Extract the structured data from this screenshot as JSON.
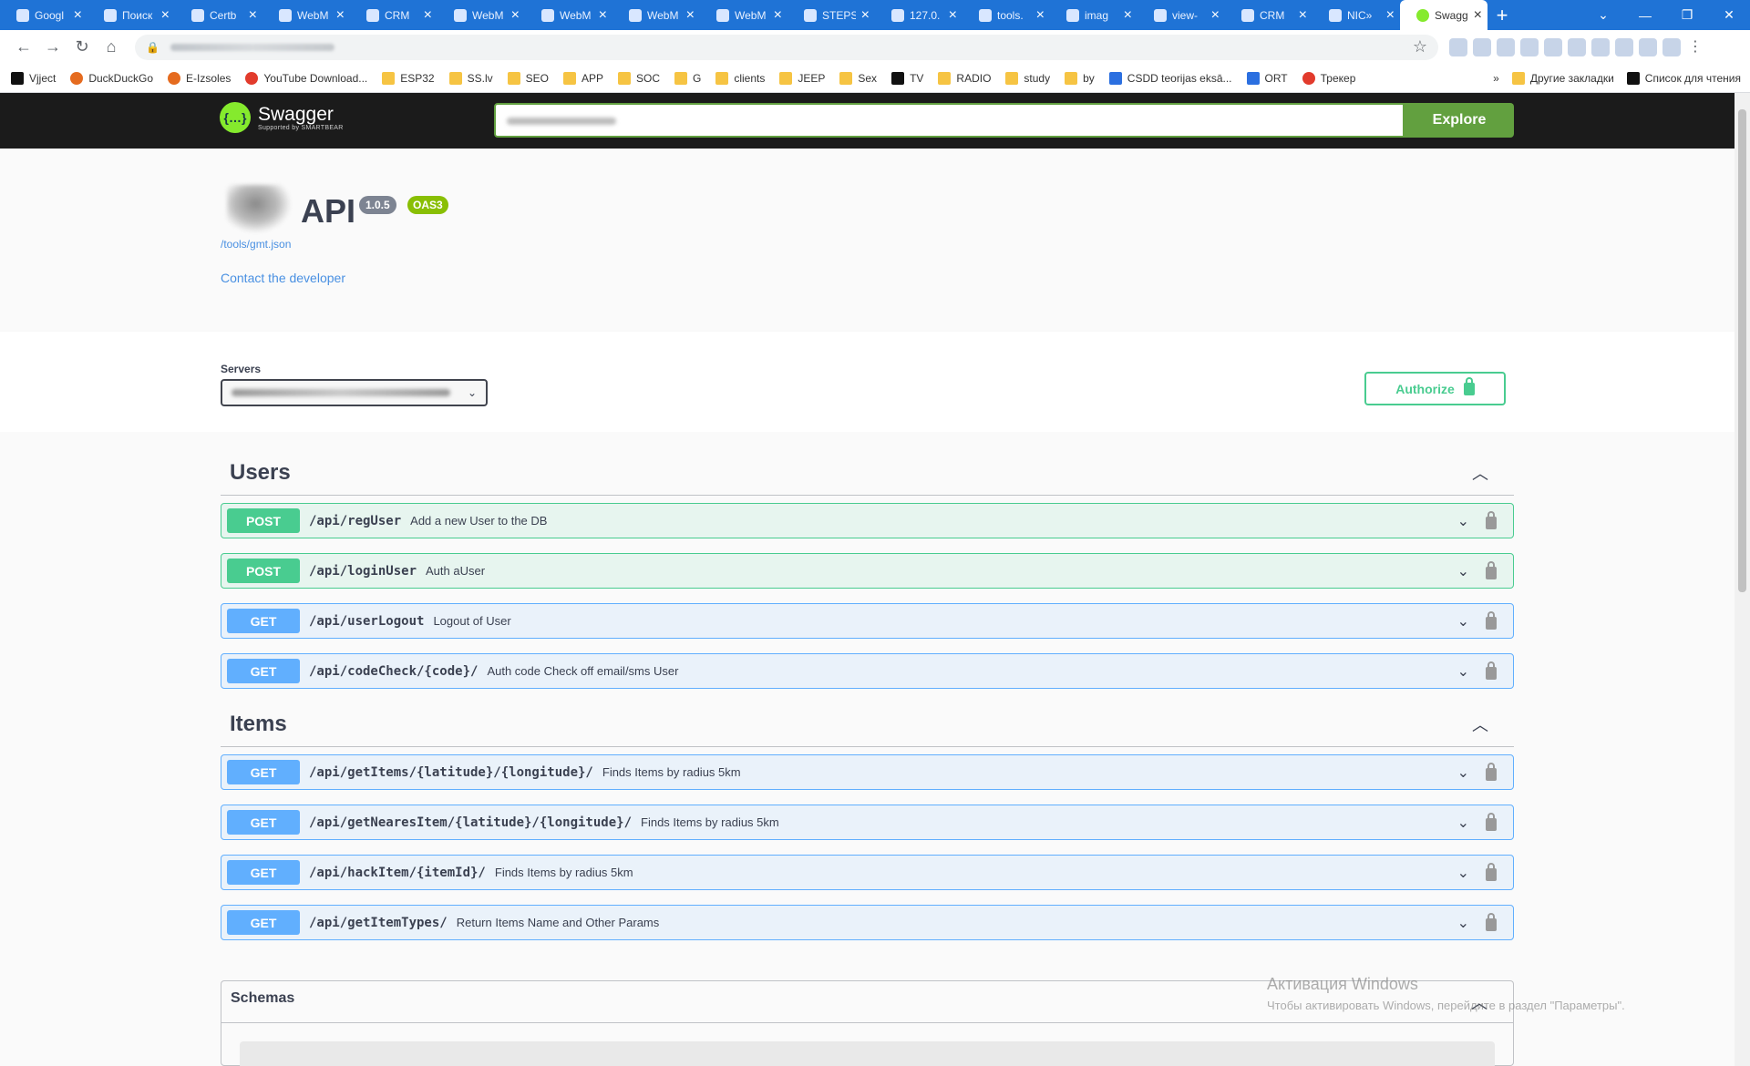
{
  "browser": {
    "tabs": [
      {
        "label": "Googl"
      },
      {
        "label": "Поиск"
      },
      {
        "label": "Certb"
      },
      {
        "label": "WebM"
      },
      {
        "label": "CRM"
      },
      {
        "label": "WebM"
      },
      {
        "label": "WebM"
      },
      {
        "label": "WebM"
      },
      {
        "label": "WebM"
      },
      {
        "label": "STEPS"
      },
      {
        "label": "127.0."
      },
      {
        "label": "tools."
      },
      {
        "label": "imag"
      },
      {
        "label": "view-"
      },
      {
        "label": "CRM"
      },
      {
        "label": "NIC»"
      },
      {
        "label": "Swagg"
      }
    ],
    "new_tab": "+",
    "bookmarks": [
      {
        "label": "Vjject",
        "icon": "v-icon"
      },
      {
        "label": "DuckDuckGo",
        "icon": "duck-icon"
      },
      {
        "label": "E-Izsoles",
        "icon": "e-icon"
      },
      {
        "label": "YouTube Download...",
        "icon": "youtube-icon"
      },
      {
        "label": "ESP32",
        "icon": "folder-icon"
      },
      {
        "label": "SS.lv",
        "icon": "folder-icon"
      },
      {
        "label": "SEO",
        "icon": "folder-icon"
      },
      {
        "label": "APP",
        "icon": "folder-icon"
      },
      {
        "label": "SOC",
        "icon": "folder-icon"
      },
      {
        "label": "G",
        "icon": "folder-icon"
      },
      {
        "label": "clients",
        "icon": "folder-icon"
      },
      {
        "label": "JEEP",
        "icon": "folder-icon"
      },
      {
        "label": "Sex",
        "icon": "folder-icon"
      },
      {
        "label": "TV",
        "icon": "v-icon"
      },
      {
        "label": "RADIO",
        "icon": "folder-icon"
      },
      {
        "label": "study",
        "icon": "folder-icon"
      },
      {
        "label": "by",
        "icon": "folder-icon"
      },
      {
        "label": "CSDD teorijas eksā...",
        "icon": "csdd-icon"
      },
      {
        "label": "ORT",
        "icon": "ort-icon"
      },
      {
        "label": "Трекер",
        "icon": "tracker-icon"
      }
    ],
    "bookmarks_more": "»",
    "other_bookmarks": "Другие закладки",
    "reading_list": "Список для чтения"
  },
  "swagger": {
    "brand": "Swagger",
    "brand_sub": "Supported by SMARTBEAR",
    "explore_label": "Explore",
    "info": {
      "title": "API",
      "version": "1.0.5",
      "oas": "OAS3",
      "spec_link": "/tools/gmt.json",
      "contact": "Contact the developer"
    },
    "servers_label": "Servers",
    "authorize_label": "Authorize",
    "tags": [
      {
        "name": "Users",
        "operations": [
          {
            "method": "POST",
            "path": "/api/regUser",
            "summary": "Add a new User to the DB"
          },
          {
            "method": "POST",
            "path": "/api/loginUser",
            "summary": "Auth aUser"
          },
          {
            "method": "GET",
            "path": "/api/userLogout",
            "summary": "Logout of User"
          },
          {
            "method": "GET",
            "path": "/api/codeCheck/{code}/",
            "summary": "Auth code Check off email/sms User"
          }
        ]
      },
      {
        "name": "Items",
        "operations": [
          {
            "method": "GET",
            "path": "/api/getItems/{latitude}/{longitude}/",
            "summary": "Finds Items by radius 5km"
          },
          {
            "method": "GET",
            "path": "/api/getNearesItem/{latitude}/{longitude}/",
            "summary": "Finds Items by radius 5km"
          },
          {
            "method": "GET",
            "path": "/api/hackItem/{itemId}/",
            "summary": "Finds Items by radius 5km"
          },
          {
            "method": "GET",
            "path": "/api/getItemTypes/",
            "summary": "Return Items Name and Other Params"
          }
        ]
      }
    ],
    "schemas_label": "Schemas"
  },
  "watermark": {
    "line1": "Активация Windows",
    "line2": "Чтобы активировать Windows, перейдите в раздел \"Параметры\"."
  },
  "colors": {
    "post": "#49cc90",
    "get": "#61affe",
    "topbar": "#1b1b1b",
    "explore": "#62a03f"
  }
}
